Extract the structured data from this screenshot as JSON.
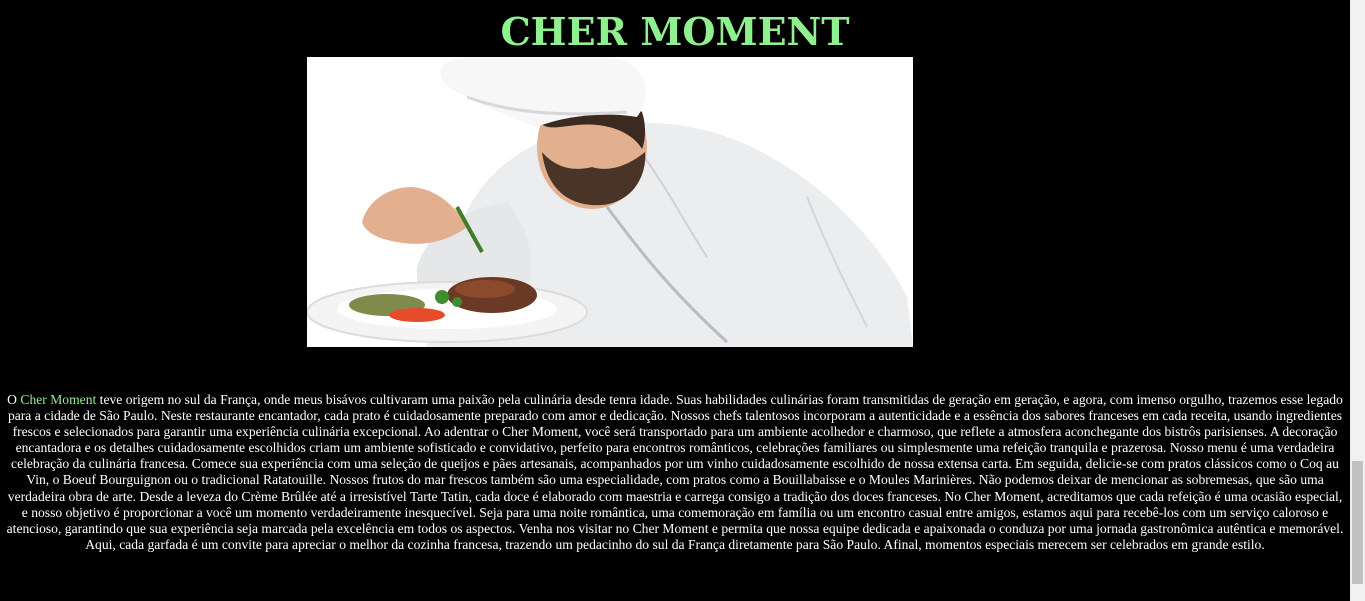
{
  "page": {
    "title": "CHER MOMENT",
    "hero_image_alt": "Chef plating a dish",
    "story": {
      "intro": "O ",
      "brand": "Cher Moment",
      "body": " teve origem no sul da França, onde meus bisávos cultivaram uma paixão pela culinária desde tenra idade. Suas habilidades culinárias foram transmitidas de geração em geração, e agora, com imenso orgulho, trazemos esse legado para a cidade de São Paulo. Neste restaurante encantador, cada prato é cuidadosamente preparado com amor e dedicação. Nossos chefs talentosos incorporam a autenticidade e a essência dos sabores franceses em cada receita, usando ingredientes frescos e selecionados para garantir uma experiência culinária excepcional. Ao adentrar o Cher Moment, você será transportado para um ambiente acolhedor e charmoso, que reflete a atmosfera aconchegante dos bistrôs parisienses. A decoração encantadora e os detalhes cuidadosamente escolhidos criam um ambiente sofisticado e convidativo, perfeito para encontros românticos, celebrações familiares ou simplesmente uma refeição tranquila e prazerosa. Nosso menu é uma verdadeira celebração da culinária francesa. Comece sua experiência com uma seleção de queijos e pães artesanais, acompanhados por um vinho cuidadosamente escolhido de nossa extensa carta. Em seguida, delicie-se com pratos clássicos como o Coq au Vin, o Boeuf Bourguignon ou o tradicional Ratatouille. Nossos frutos do mar frescos também são uma especialidade, com pratos como a Bouillabaisse e o Moules Marinières. Não podemos deixar de mencionar as sobremesas, que são uma verdadeira obra de arte. Desde a leveza do Crème Brûlée até a irresistível Tarte Tatin, cada doce é elaborado com maestria e carrega consigo a tradição dos doces franceses. No Cher Moment, acreditamos que cada refeição é uma ocasião especial, e nosso objetivo é proporcionar a você um momento verdadeiramente inesquecível. Seja para uma noite romântica, uma comemoração em família ou um encontro casual entre amigos, estamos aqui para recebê-los com um serviço caloroso e atencioso, garantindo que sua experiência seja marcada pela excelência em todos os aspectos. Venha nos visitar no Cher Moment e permita que nossa equipe dedicada e apaixonada o conduza por uma jornada gastronômica autêntica e memorável. Aqui, cada garfada é um convite para apreciar o melhor da cozinha francesa, trazendo um pedacinho do sul da França diretamente para São Paulo. Afinal, momentos especiais merecem ser celebrados em grande estilo."
    }
  },
  "scrollbar": {
    "thumb_start": 0.767,
    "thumb_end": 0.972
  },
  "colors": {
    "background": "#000000",
    "accent": "#8ef08e",
    "text": "#ffffff"
  }
}
